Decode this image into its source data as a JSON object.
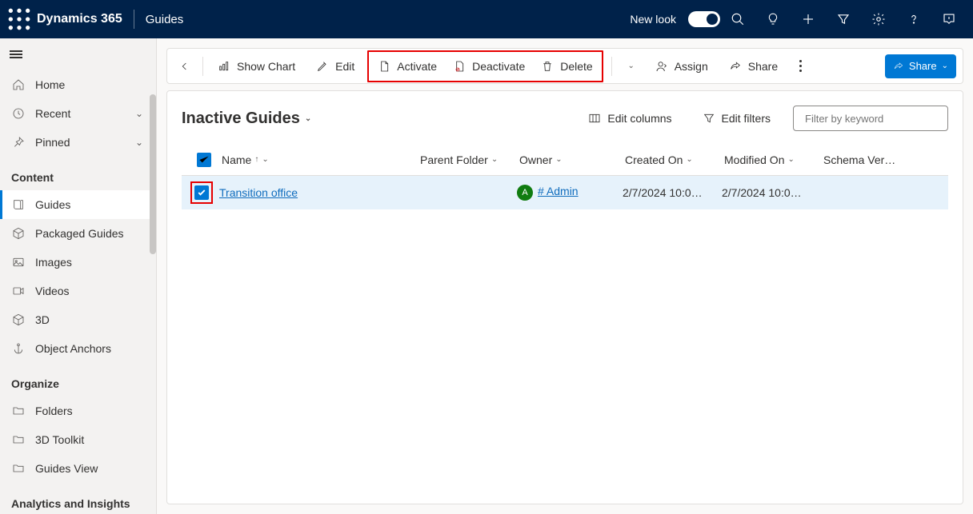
{
  "topbar": {
    "brand": "Dynamics 365",
    "app": "Guides",
    "newlook": "New look"
  },
  "sidebar": {
    "home": "Home",
    "recent": "Recent",
    "pinned": "Pinned",
    "sections": {
      "content": "Content",
      "organize": "Organize",
      "analytics": "Analytics and Insights"
    },
    "content_items": {
      "guides": "Guides",
      "packaged": "Packaged Guides",
      "images": "Images",
      "videos": "Videos",
      "three_d": "3D",
      "anchors": "Object Anchors"
    },
    "organize_items": {
      "folders": "Folders",
      "toolkit": "3D Toolkit",
      "guides_view": "Guides View"
    }
  },
  "cmdbar": {
    "show_chart": "Show Chart",
    "edit": "Edit",
    "activate": "Activate",
    "deactivate": "Deactivate",
    "delete": "Delete",
    "assign": "Assign",
    "share": "Share",
    "share_primary": "Share"
  },
  "view": {
    "title": "Inactive Guides",
    "edit_columns": "Edit columns",
    "edit_filters": "Edit filters",
    "search_placeholder": "Filter by keyword"
  },
  "columns": {
    "name": "Name",
    "parent": "Parent Folder",
    "owner": "Owner",
    "created": "Created On",
    "modified": "Modified On",
    "schema": "Schema Ver…"
  },
  "rows": [
    {
      "name": "Transition office",
      "owner_initial": "A",
      "owner": "# Admin",
      "created": "2/7/2024 10:0…",
      "modified": "2/7/2024 10:0…"
    }
  ]
}
